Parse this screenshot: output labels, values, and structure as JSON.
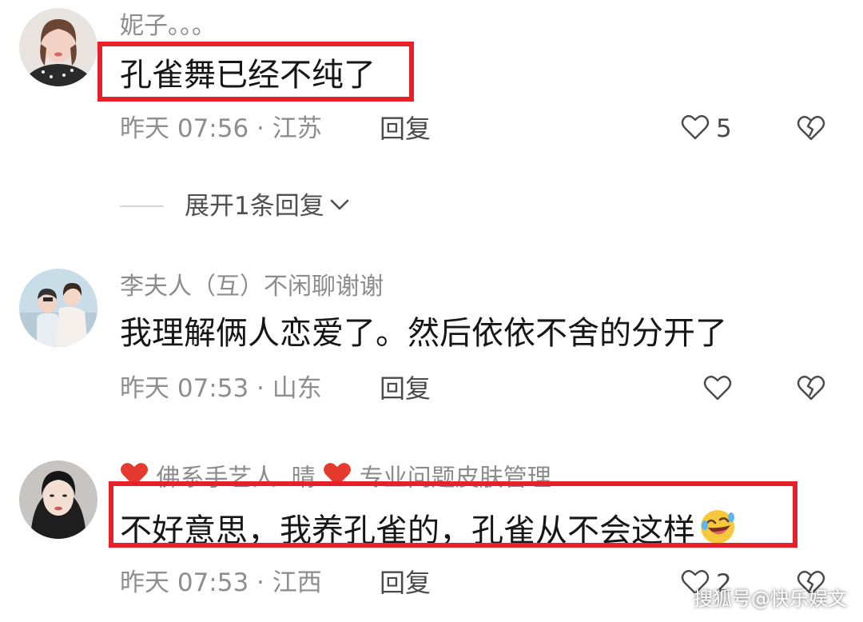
{
  "comments": [
    {
      "username": "妮子。。。",
      "content": "孔雀舞已经不纯了",
      "meta": "昨天 07:56 · 江苏",
      "reply_label": "回复",
      "likes": "5"
    },
    {
      "username": "李夫人（互）不闲聊谢谢",
      "content": "我理解俩人恋爱了。然后依依不舍的分开了",
      "meta": "昨天 07:53 · 山东",
      "reply_label": "回复",
      "likes": ""
    },
    {
      "username_part1": "佛系手艺人 .晴",
      "username_part2": "专业问题皮肤管理",
      "content": "不好意思，我养孔雀的，孔雀从不会这样",
      "meta": "昨天 07:53 · 江西",
      "reply_label": "回复",
      "likes": "2"
    }
  ],
  "expand_replies": {
    "label": "展开1条回复"
  },
  "watermark": "搜狐号@快乐娱文",
  "colors": {
    "highlight": "#e8202a",
    "secondary_text": "#8e8e8e",
    "primary_text": "#161616"
  },
  "icons": {
    "like": "heart-outline-icon",
    "dislike": "broken-heart-icon",
    "expand": "chevron-down-icon",
    "emoji": "rolling-laughing-emoji",
    "badge": "red-heart-emoji"
  }
}
